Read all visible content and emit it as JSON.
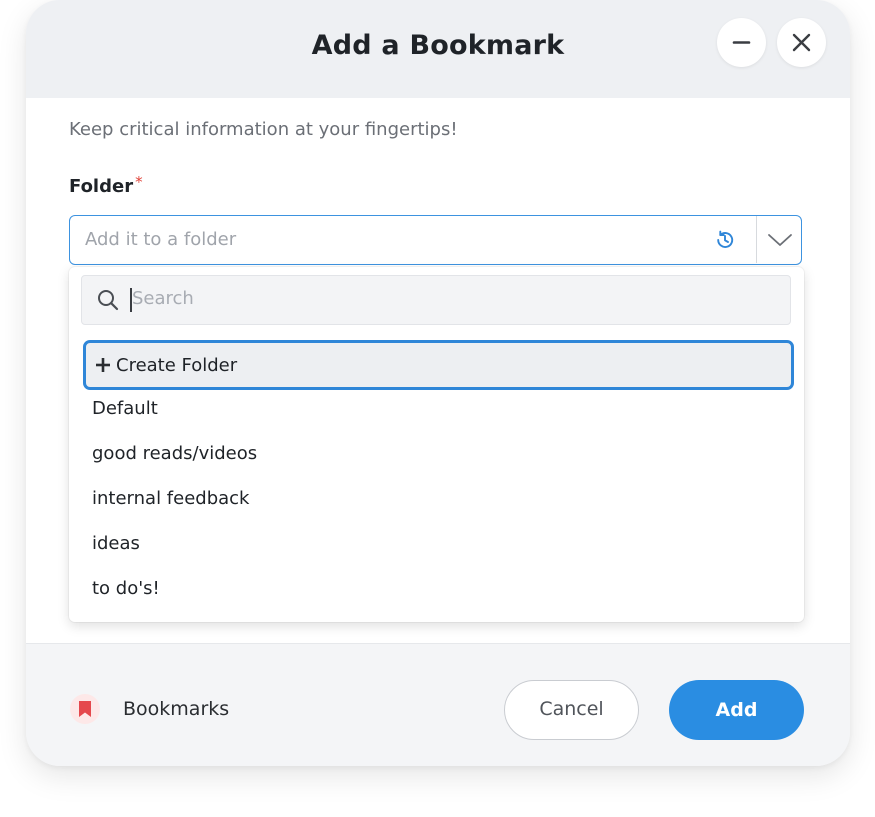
{
  "dialog": {
    "title": "Add a Bookmark",
    "subtitle": "Keep critical information at your fingertips!"
  },
  "folder_field": {
    "label": "Folder",
    "required_marker": "*",
    "placeholder": "Add it to a folder",
    "history_icon": "history-icon",
    "dropdown_icon": "chevron-down-icon"
  },
  "dropdown": {
    "search_placeholder": "Search",
    "create_folder_label": "Create Folder",
    "folders": [
      "Default",
      "good reads/videos",
      "internal feedback",
      "ideas",
      "to do's!"
    ]
  },
  "footer": {
    "bookmarks_label": "Bookmarks",
    "cancel_label": "Cancel",
    "add_label": "Add"
  },
  "colors": {
    "accent": "#2a8de2",
    "focus_border": "#2f86d8",
    "required": "#e0443a",
    "bookmark_icon": "#e5484d"
  }
}
